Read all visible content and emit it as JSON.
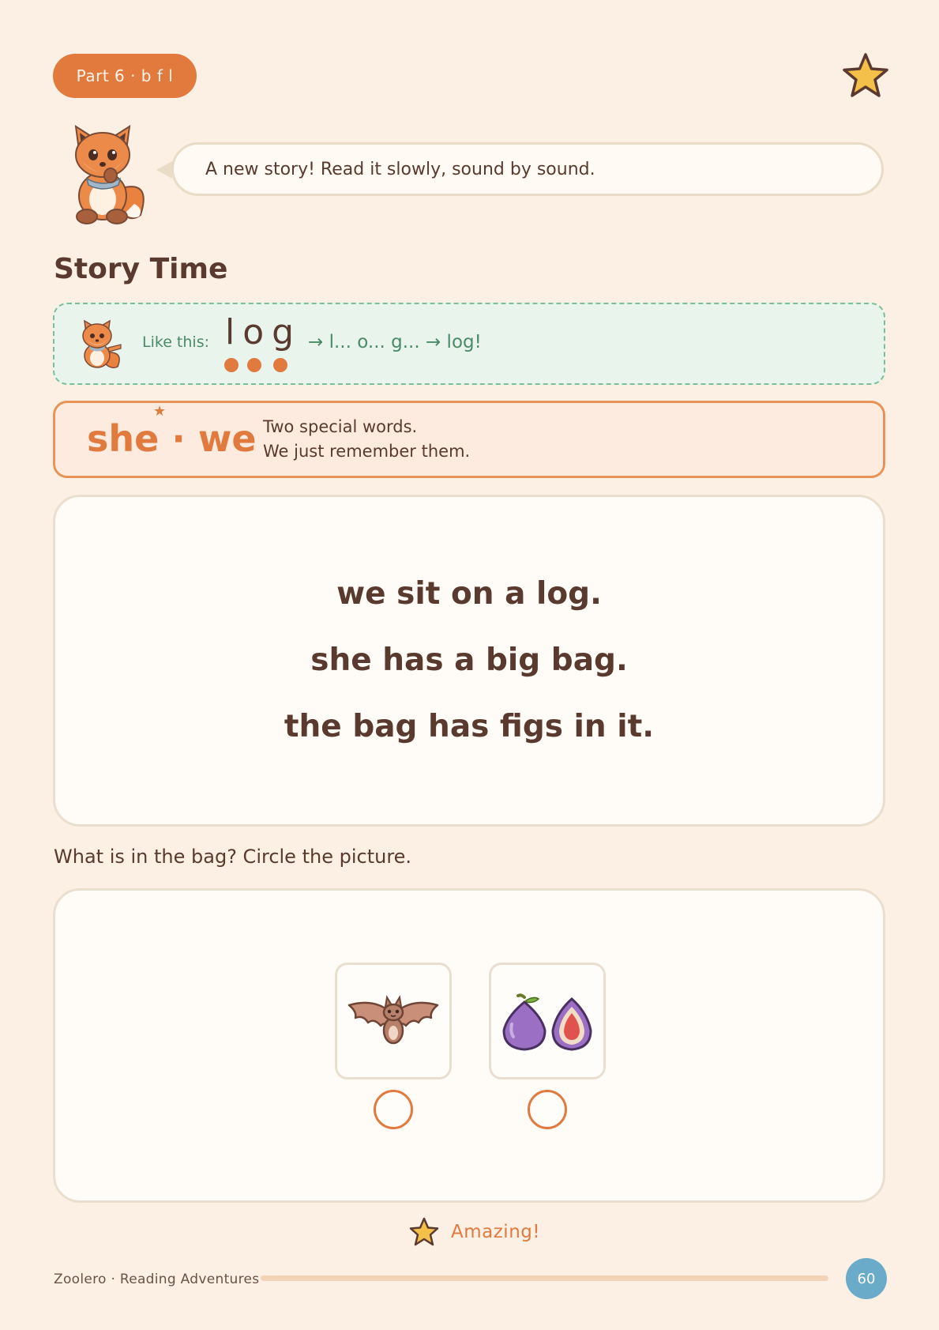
{
  "header": {
    "part_label": "Part 6 · b f l",
    "star_icon": "star-icon"
  },
  "mascot": {
    "speech": "A new story! Read it slowly, sound by sound."
  },
  "section": {
    "title": "Story Time"
  },
  "example": {
    "label": "Like this:",
    "word": "log",
    "sound_count": 3,
    "chain": "→ l... o... g... → log!"
  },
  "special_words": {
    "words": "she · we",
    "line1": "Two special words.",
    "line2": "We just remember them."
  },
  "story": {
    "lines": [
      "we sit on a log.",
      "she has a big bag.",
      "the bag has figs in it."
    ]
  },
  "question": {
    "prompt": "What is in the bag? Circle the picture.",
    "choices": [
      {
        "name": "bat",
        "icon": "bat-icon"
      },
      {
        "name": "figs",
        "icon": "figs-icon"
      }
    ]
  },
  "praise": {
    "text": "Amazing!"
  },
  "footer": {
    "brand": "Zoolero · Reading Adventures",
    "page_number": "60"
  },
  "colors": {
    "page_bg": "#fbf0e3",
    "accent_orange": "#e27a3e",
    "example_green": "#4a8a66",
    "page_badge_blue": "#69abc8",
    "text_brown": "#5a3a2e"
  }
}
